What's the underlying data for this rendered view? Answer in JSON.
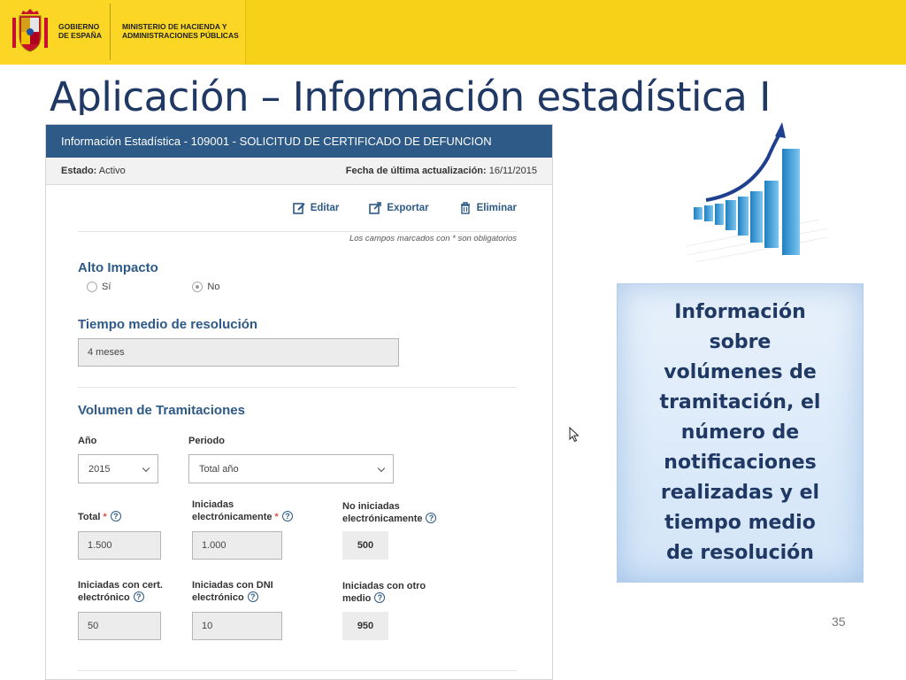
{
  "banner": {
    "gov_name": "Gobierno de España",
    "ministry": "Ministerio de Hacienda y Administraciones Públicas"
  },
  "slide": {
    "title": "Aplicación – Información estadística I",
    "page_number": "35"
  },
  "panel": {
    "header": "Información Estadística - 109001 - SOLICITUD DE CERTIFICADO DE DEFUNCION",
    "estado_label": "Estado:",
    "estado_value": "Activo",
    "fecha_label": "Fecha de última actualización:",
    "fecha_value": "16/11/2015",
    "toolbar": {
      "edit": "Editar",
      "export": "Exportar",
      "delete": "Eliminar"
    },
    "required_note": "Los campos marcados con * son obligatorios",
    "alto_impacto": {
      "title": "Alto Impacto",
      "option_yes": "Sí",
      "option_no": "No",
      "selected": "No"
    },
    "tiempo": {
      "title": "Tiempo medio de resolución",
      "value": "4 meses"
    },
    "volumen": {
      "title": "Volumen de Tramitaciones",
      "anio_label": "Año",
      "anio_value": "2015",
      "periodo_label": "Periodo",
      "periodo_value": "Total año",
      "total_label": "Total",
      "total_value": "1.500",
      "iniciadas_elec_label_1": "Iniciadas",
      "iniciadas_elec_label_2": "electrónicamente",
      "iniciadas_elec_value": "1.000",
      "no_iniciadas_label_1": "No iniciadas",
      "no_iniciadas_label_2": "electrónicamente",
      "no_iniciadas_value": "500",
      "cert_label_1": "Iniciadas con cert.",
      "cert_label_2": "electrónico",
      "cert_value": "50",
      "dni_label_1": "Iniciadas con DNI",
      "dni_label_2": "electrónico",
      "dni_value": "10",
      "otro_label_1": "Iniciadas con otro",
      "otro_label_2": "medio",
      "otro_value": "950"
    }
  },
  "info_box": {
    "text": "Información sobre volúmenes de tramitación, el número de notificaciones realizadas y el tiempo medio de resolución"
  },
  "colors": {
    "banner": "#f7d117",
    "panel_header": "#2d5a87",
    "title": "#1f3864",
    "required_star": "#d9534f"
  }
}
